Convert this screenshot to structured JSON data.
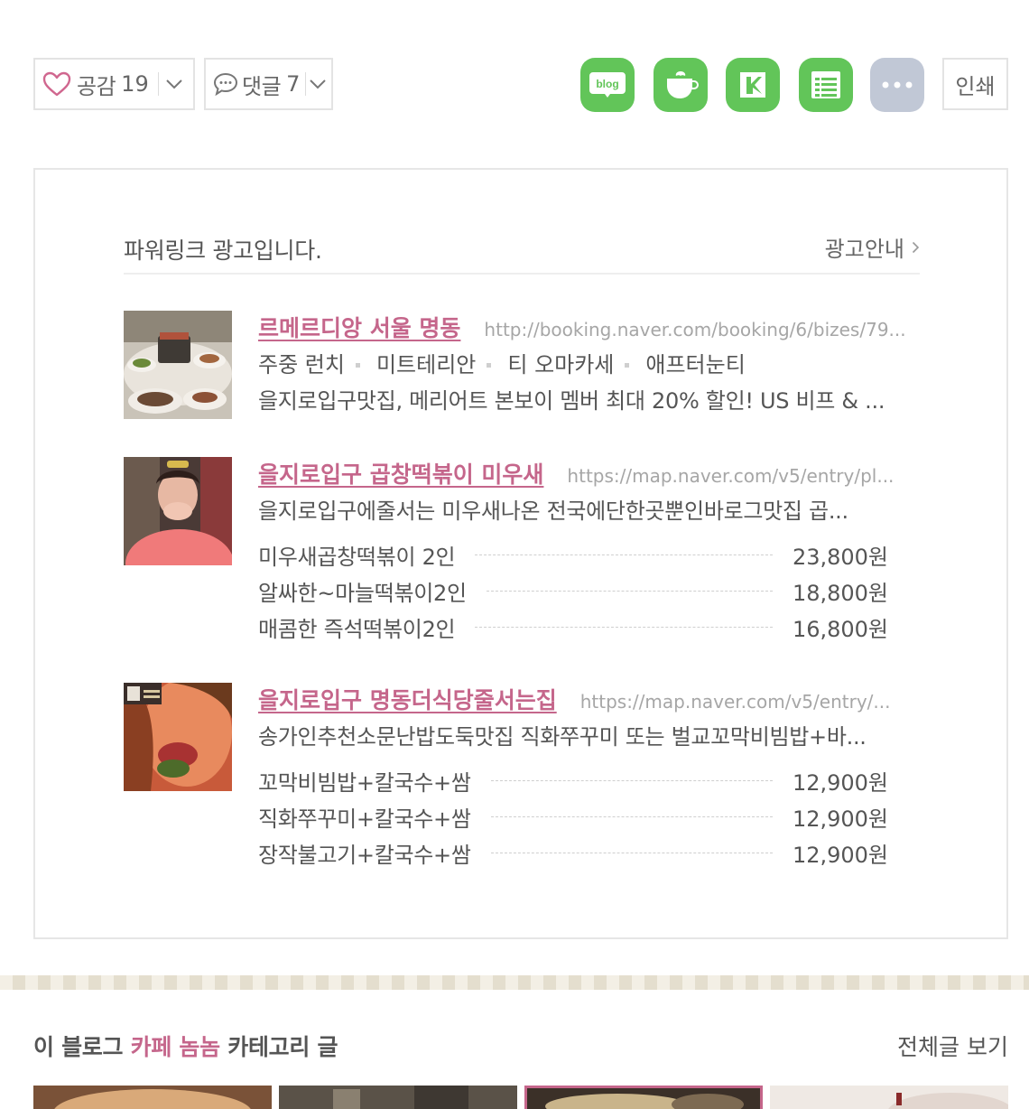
{
  "reactions": {
    "like_label": "공감",
    "like_count": "19",
    "comment_label": "댓글",
    "comment_count": "7"
  },
  "share": {
    "icons": [
      "blog-icon",
      "cafe-cup-icon",
      "bookmark-keep-icon",
      "memo-list-icon",
      "more-icon"
    ],
    "print_label": "인쇄"
  },
  "ad": {
    "title": "파워링크 광고입니다.",
    "guide_label": "광고안내",
    "items": [
      {
        "name": "르메르디앙 서울 명동",
        "url": "http://booking.naver.com/booking/6/bizes/79...",
        "tags": [
          "주중 런치",
          "미트테리안",
          "티 오마카세",
          "애프터눈티"
        ],
        "desc": "을지로입구맛집, 메리어트 본보이 멤버 최대 20% 할인! US 비프 & ..."
      },
      {
        "name": "을지로입구 곱창떡볶이 미우새",
        "url": "https://map.naver.com/v5/entry/pl...",
        "desc": "을지로입구에줄서는 미우새나온 전국에단한곳뿐인바로그맛집 곱...",
        "menus": [
          {
            "name": "미우새곱창떡볶이 2인",
            "price": "23,800원"
          },
          {
            "name": "알싸한~마늘떡볶이2인",
            "price": "18,800원"
          },
          {
            "name": "매콤한 즉석떡볶이2인",
            "price": "16,800원"
          }
        ]
      },
      {
        "name": "을지로입구 명동더식당줄서는집",
        "url": "https://map.naver.com/v5/entry/...",
        "desc": "송가인추천소문난밥도둑맛집 직화쭈꾸미 또는 벌교꼬막비빔밥+바...",
        "menus": [
          {
            "name": "꼬막비빔밥+칼국수+쌈",
            "price": "12,900원"
          },
          {
            "name": "직화쭈꾸미+칼국수+쌈",
            "price": "12,900원"
          },
          {
            "name": "장작불고기+칼국수+쌈",
            "price": "12,900원"
          }
        ]
      }
    ]
  },
  "category": {
    "prefix": "이 블로그",
    "name": "카페 놈놈",
    "suffix": "카테고리 글",
    "view_all": "전체글 보기"
  },
  "colors": {
    "accent": "#c5668b",
    "share_green": "#62c559",
    "share_gray": "#c1c8d6",
    "border": "#e3e3e3"
  }
}
